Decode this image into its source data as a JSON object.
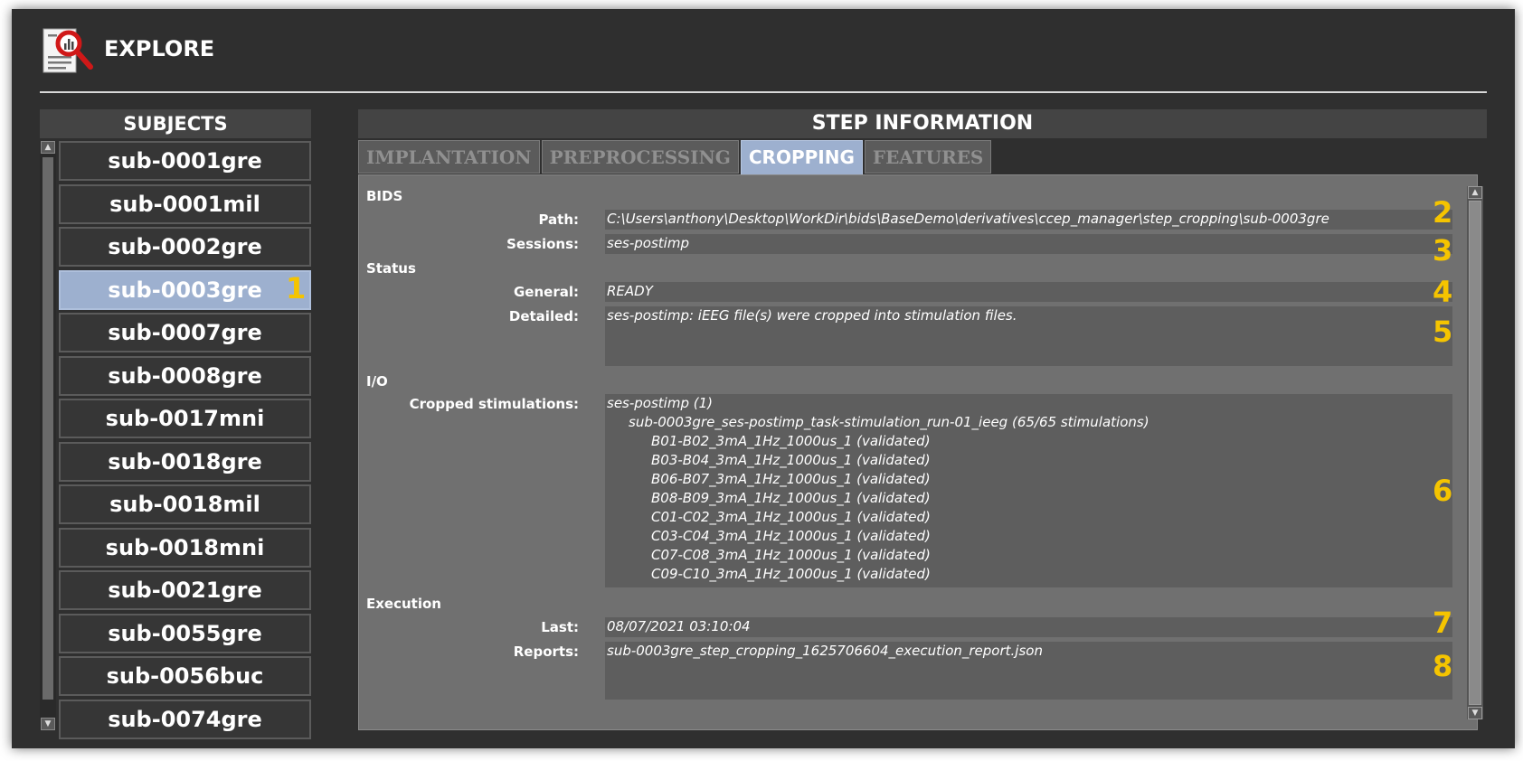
{
  "header": {
    "title": "EXPLORE",
    "icon": "report-magnifier-icon"
  },
  "subjects": {
    "title": "SUBJECTS",
    "items": [
      {
        "label": "sub-0001gre"
      },
      {
        "label": "sub-0001mil"
      },
      {
        "label": "sub-0002gre"
      },
      {
        "label": "sub-0003gre",
        "selected": true
      },
      {
        "label": "sub-0007gre"
      },
      {
        "label": "sub-0008gre"
      },
      {
        "label": "sub-0017mni"
      },
      {
        "label": "sub-0018gre"
      },
      {
        "label": "sub-0018mil"
      },
      {
        "label": "sub-0018mni"
      },
      {
        "label": "sub-0021gre"
      },
      {
        "label": "sub-0055gre"
      },
      {
        "label": "sub-0056buc"
      },
      {
        "label": "sub-0074gre"
      }
    ]
  },
  "step": {
    "title": "STEP INFORMATION",
    "tabs": [
      {
        "label": "IMPLANTATION"
      },
      {
        "label": "PREPROCESSING"
      },
      {
        "label": "CROPPING",
        "active": true
      },
      {
        "label": "FEATURES"
      }
    ],
    "bids": {
      "section": "BIDS",
      "path_label": "Path:",
      "path": "C:\\Users\\anthony\\Desktop\\WorkDir\\bids\\BaseDemo\\derivatives\\ccep_manager\\step_cropping\\sub-0003gre",
      "sessions_label": "Sessions:",
      "sessions": "ses-postimp"
    },
    "status": {
      "section": "Status",
      "general_label": "General:",
      "general": "READY",
      "detailed_label": "Detailed:",
      "detailed": "ses-postimp: iEEG file(s) were cropped into stimulation files."
    },
    "io": {
      "section": "I/O",
      "cropped_label": "Cropped stimulations:",
      "lines": [
        "ses-postimp (1)",
        "sub-0003gre_ses-postimp_task-stimulation_run-01_ieeg (65/65 stimulations)",
        "B01-B02_3mA_1Hz_1000us_1 (validated)",
        "B03-B04_3mA_1Hz_1000us_1 (validated)",
        "B06-B07_3mA_1Hz_1000us_1 (validated)",
        "B08-B09_3mA_1Hz_1000us_1 (validated)",
        "C01-C02_3mA_1Hz_1000us_1 (validated)",
        "C03-C04_3mA_1Hz_1000us_1 (validated)",
        "C07-C08_3mA_1Hz_1000us_1 (validated)",
        "C09-C10_3mA_1Hz_1000us_1 (validated)"
      ]
    },
    "execution": {
      "section": "Execution",
      "last_label": "Last:",
      "last": "08/07/2021 03:10:04",
      "reports_label": "Reports:",
      "reports": "sub-0003gre_step_cropping_1625706604_execution_report.json"
    }
  },
  "callouts": [
    "1",
    "2",
    "3",
    "4",
    "5",
    "6",
    "7",
    "8"
  ],
  "colors": {
    "accent": "#9db0cf",
    "callout": "#f5c400",
    "window": "#2f2f2f",
    "panel": "#707070"
  }
}
